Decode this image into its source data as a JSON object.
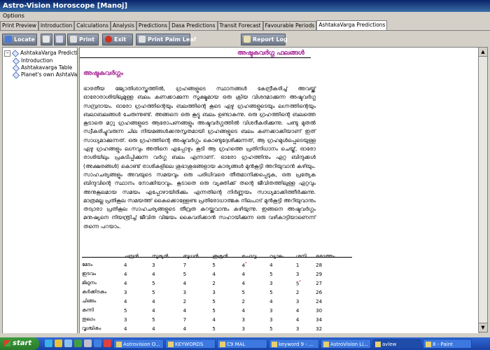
{
  "window": {
    "title": "Astro-Vision Horoscope [Manoj]"
  },
  "menu": {
    "options": "Options"
  },
  "tabs": [
    "Print Preview",
    "Introduction",
    "Calculations",
    "Analysis",
    "Predictions",
    "Dasa Predictions",
    "Transit Forecast",
    "Favourable Periods",
    "AshtakaVarga Predictions"
  ],
  "toolbar": {
    "locate": "Locate",
    "print": "Print",
    "exit": "Exit",
    "print_palm_leaf": "Print Palm Leaf",
    "report_log": "Report Log"
  },
  "tree": {
    "root": "AshtakaVarga Predictions",
    "items": [
      "Introduction",
      "Ashtakavarga Table",
      "Planet's own AshtaVar"
    ]
  },
  "doc": {
    "heading": "അഷ്ടകവർഗ്ഗ ഫലങ്ങൾ",
    "section_title": "അഷ്ടകവർഗ്ഗം",
    "paragraph": "ഭാരതീയ ജ്യോതിശാസ്ത്രത്തിൽ, ഗ്രഹങ്ങളുടെ സ്ഥാനങ്ങൾ കേന്ദ്രീകരിച്ച് അവയ്ക്ക് ഓരോരാശിയിലുമുള്ള ബലം കണക്കാക്കുന്ന സൂക്ഷ്മമായ ഒരു ക്രിയ വിശദമാക്കുന്ന അഷ്ടവർഗ്ഗ സമ്പ്രദായം. ഓരോ ഗ്രഹത്തിന്റെയും ബലത്തിന്റെ കൂടെ ഏഴു ഗ്രഹങ്ങളുടെയും ലഗ്നത്തിന്റെയും ബലാബലങ്ങൾ ചേരുന്നുണ്ട്. അങ്ങനെ ഒരു കൂട്ടു ബലം ഉണ്ടാകുന്നു. ഒരു ഗ്രഹത്തിന്റെ ബലത്തെ കൂടാതെ മറ്റു ഗ്രഹങ്ങളുടെ ആരോപണങ്ങളും അഷ്ടവർഗ്ഗത്തിൽ വിശദീകരിക്കുന്നു. പണ്ടു മുതൽ സ്വീകരിച്ചുവരുന്ന ചില നിയമങ്ങൾക്കനുസൃതമായി ഗ്രഹങ്ങളുടെ ബലം കണക്കാക്കിയാണ് ഇത് സാധ്യമാക്കുന്നത്. ഒരു ഗ്രഹത്തിന്റെ അഷ്ടവർഗ്ഗം കൊണ്ടുദ്ദേശിക്കുന്നത്, ആ ഗ്രഹമുൾപ്പെടെയുള്ള ഏഴു ഗ്രഹങ്ങളും ലഗ്നവും അതിനെ എപ്പോഴും കൂടി ആ ഗ്രഹത്തെ പ്രതിനിധാനം ചെയ്ത്, ഓരോ രാശിയിലും പ്രകടിപ്പിക്കുന്ന വർഗ്ഗ ബലം എന്നാണ്. ഓരോ ഗ്രഹത്തിനും ഏറ്റ ബിന്ദുക്കൾ (അക്ഷരങ്ങൾ) കൊണ്ട് രാശികളിലെ ശുഭാശുഭങ്ങളായ കാര്യങ്ങൾ മുൻകൂട്ടി അറിയുവാൻ കഴിയും. സാഹചര്യങ്ങളും അവയുടെ സമയവും ഒരു പരിധിവരെ തീരുമാനിക്കപ്പെടുക, ഒരു പ്രത്യേക ബിന്ദുവിന്റെ സ്ഥാനം നോക്കിയാവും. കൂടാതെ ഒരു വ്യക്തിക്ക് തന്റെ ജീവിതത്തിലുള്ള ഏറ്റവും അനുകൂലമായ സമയം എപ്പോഴായിരിക്കും എന്നതിന്റെ നിർണ്ണയം സാധ്യമാക്കിത്തീർക്കുന്നു. മാത്രമല്ല പ്രതികൂല സമയത്ത് കൈക്കൊള്ളേണ്ട പ്രതിരോധാത്മക നിലപാട് മുൻകൂട്ടി അറിയുവാനും തദ്വാരാ പ്രതികൂല സാഹചര്യങ്ങളുടെ തീവ്രത കുറയ്ക്കുവാനും കഴിയുന്നു. ഇങ്ങനെ അഷ്ടവർഗ്ഗം മനുഷ്യനെ നിയന്ത്രിച്ച് ജീവിത വിജയം കൈവരിക്കാൻ സഹായിക്കുന്ന ഒരു വഴികാട്ടിയാണെന്ന് തന്നെ പറയാം."
  },
  "table": {
    "headers": [
      "",
      "ചന്ദ്രൻ",
      "സൂര്യൻ",
      "ബുധൻ",
      "ശുക്രൻ",
      "ചൊവ്വ",
      "വ്യാഴം",
      "ശനി",
      "മൊത്തം"
    ],
    "rows": [
      {
        "sign": "മേടം",
        "values": [
          "4",
          "3",
          "7",
          "5",
          "4",
          "4",
          "1",
          "28"
        ],
        "star": [
          false,
          false,
          false,
          false,
          true,
          false,
          false,
          false
        ]
      },
      {
        "sign": "ഇടവം",
        "values": [
          "4",
          "4",
          "5",
          "4",
          "4",
          "5",
          "3",
          "29"
        ],
        "star": [
          false,
          false,
          false,
          false,
          false,
          false,
          false,
          false
        ]
      },
      {
        "sign": "മിഥുനം",
        "values": [
          "4",
          "5",
          "4",
          "2",
          "4",
          "3",
          "5",
          "27"
        ],
        "star": [
          false,
          false,
          false,
          false,
          false,
          false,
          true,
          false
        ]
      },
      {
        "sign": "കർക്കിടകം",
        "values": [
          "3",
          "5",
          "3",
          "3",
          "5",
          "5",
          "2",
          "26"
        ],
        "star": [
          false,
          false,
          false,
          false,
          false,
          false,
          false,
          false
        ]
      },
      {
        "sign": "ചിങ്ങം",
        "values": [
          "4",
          "4",
          "2",
          "5",
          "2",
          "4",
          "3",
          "24"
        ],
        "star": [
          false,
          false,
          false,
          false,
          false,
          false,
          false,
          false
        ]
      },
      {
        "sign": "കന്നി",
        "values": [
          "5",
          "4",
          "4",
          "5",
          "4",
          "3",
          "4",
          "30"
        ],
        "star": [
          false,
          false,
          false,
          false,
          false,
          false,
          false,
          false
        ]
      },
      {
        "sign": "തുലാം",
        "values": [
          "3",
          "5",
          "7",
          "4",
          "3",
          "3",
          "4",
          "34"
        ],
        "star": [
          false,
          false,
          false,
          false,
          false,
          false,
          false,
          false
        ]
      },
      {
        "sign": "വൃശ്ചികം",
        "values": [
          "4",
          "4",
          "4",
          "5",
          "3",
          "5",
          "3",
          "32"
        ],
        "star": [
          false,
          false,
          false,
          false,
          false,
          false,
          false,
          false
        ]
      }
    ]
  },
  "taskbar": {
    "start": "start",
    "tasks": [
      "Astrovision O...",
      "KEYWORDS",
      "C9 MAL",
      "keyword 9 - ...",
      "AstroVision Li...",
      "avlew",
      "8 - Paint"
    ]
  },
  "colors": {
    "accent": "#a01890",
    "title_bar": "#0a246a",
    "taskbar": "#245edb",
    "star": "#c00000"
  }
}
